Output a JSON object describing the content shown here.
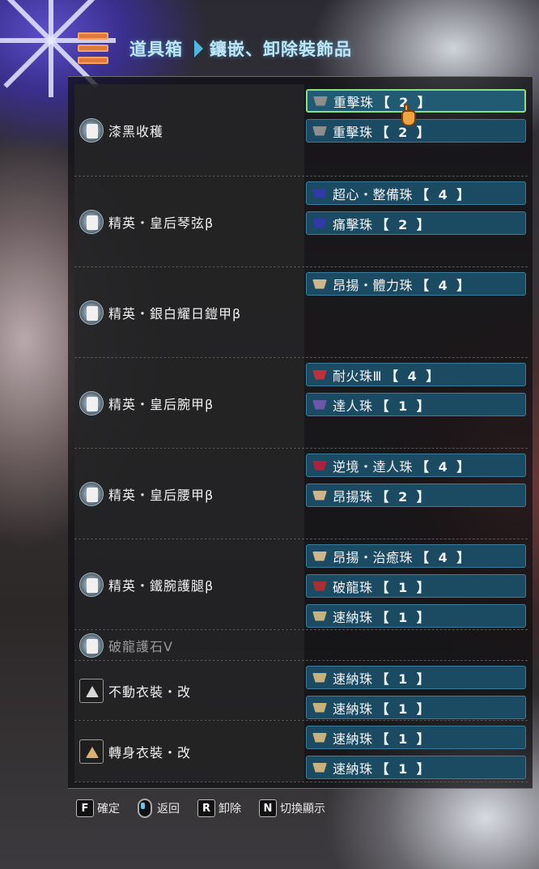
{
  "header": {
    "title": "道具箱",
    "subtitle": "鑲嵌、卸除裝飾品"
  },
  "equipment": [
    {
      "name": "漆黑收穫",
      "icon": "helm-icon",
      "decorations": [
        {
          "name": "重擊珠",
          "slot": "【 2 】",
          "gem_color": "#8e8e8e",
          "selected": true
        },
        {
          "name": "重擊珠",
          "slot": "【 2 】",
          "gem_color": "#8e8e8e",
          "selected": false
        }
      ]
    },
    {
      "name": "精英・皇后琴弦β",
      "icon": "chest-icon",
      "decorations": [
        {
          "name": "超心・整備珠",
          "slot": "【 4 】",
          "gem_color": "#2f3aa8",
          "selected": false
        },
        {
          "name": "痛擊珠",
          "slot": "【 2 】",
          "gem_color": "#2f3aa8",
          "selected": false
        }
      ]
    },
    {
      "name": "精英・銀白耀日鎧甲β",
      "icon": "armor-icon",
      "decorations": [
        {
          "name": "昂揚・體力珠",
          "slot": "【 4 】",
          "gem_color": "#cfb58a",
          "selected": false
        }
      ]
    },
    {
      "name": "精英・皇后腕甲β",
      "icon": "arm-icon",
      "decorations": [
        {
          "name": "耐火珠Ⅲ",
          "slot": "【 4 】",
          "gem_color": "#c0303a",
          "selected": false
        },
        {
          "name": "達人珠",
          "slot": "【 1 】",
          "gem_color": "#6b57a8",
          "selected": false
        }
      ]
    },
    {
      "name": "精英・皇后腰甲β",
      "icon": "waist-icon",
      "decorations": [
        {
          "name": "逆境・達人珠",
          "slot": "【 4 】",
          "gem_color": "#b0203a",
          "selected": false
        },
        {
          "name": "昂揚珠",
          "slot": "【 2 】",
          "gem_color": "#cfb58a",
          "selected": false
        }
      ]
    },
    {
      "name": "精英・鐵腕護腿β",
      "icon": "leg-icon",
      "decorations": [
        {
          "name": "昂揚・治癒珠",
          "slot": "【 4 】",
          "gem_color": "#cfb58a",
          "selected": false
        },
        {
          "name": "破龍珠",
          "slot": "【 1 】",
          "gem_color": "#a83030",
          "selected": false
        },
        {
          "name": "速納珠",
          "slot": "【 1 】",
          "gem_color": "#c8b27a",
          "selected": false
        }
      ]
    },
    {
      "name": "破龍護石Ⅴ",
      "icon": "charm-icon",
      "dim": true,
      "decorations": []
    },
    {
      "name": "不動衣裝・改",
      "icon": "mantle-icon",
      "decorations": [
        {
          "name": "速納珠",
          "slot": "【 1 】",
          "gem_color": "#c8b27a",
          "selected": false
        },
        {
          "name": "速納珠",
          "slot": "【 1 】",
          "gem_color": "#c8b27a",
          "selected": false
        }
      ]
    },
    {
      "name": "轉身衣裝・改",
      "icon": "mantle-icon",
      "decorations": [
        {
          "name": "速納珠",
          "slot": "【 1 】",
          "gem_color": "#c8b27a",
          "selected": false
        },
        {
          "name": "速納珠",
          "slot": "【 1 】",
          "gem_color": "#c8b27a",
          "selected": false
        }
      ]
    }
  ],
  "footer": {
    "confirm_key": "F",
    "confirm_label": "確定",
    "back_label": "返回",
    "remove_key": "R",
    "remove_label": "卸除",
    "toggle_key": "N",
    "toggle_label": "切換顯示"
  }
}
